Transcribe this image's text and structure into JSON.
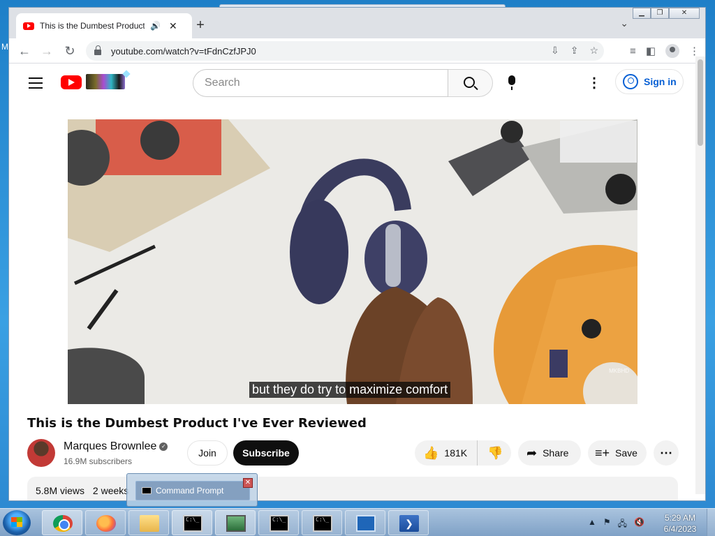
{
  "browser": {
    "tab_title": "This is the Dumbest Product I've Ever Reviewed",
    "url": "youtube.com/watch?v=tFdnCzfJPJ0"
  },
  "youtube": {
    "search_placeholder": "Search",
    "sign_in_label": "Sign in",
    "video": {
      "caption": "but they do try to maximize comfort",
      "watermark": "MKBHD",
      "title": "This is the Dumbest Product I've Ever Reviewed"
    },
    "channel": {
      "name": "Marques Brownlee",
      "subscribers": "16.9M subscribers"
    },
    "buttons": {
      "join": "Join",
      "subscribe": "Subscribe",
      "likes": "181K",
      "share": "Share",
      "save": "Save"
    },
    "description": {
      "views": "5.8M views",
      "age": "2 weeks"
    }
  },
  "desktop": {
    "edge_letter": "M"
  },
  "popup": {
    "label": "Command Prompt"
  },
  "taskbar": {
    "time": "5:29 AM",
    "date": "6/4/2023"
  },
  "colors": {
    "youtube_red": "#ff0000",
    "subscribe_bg": "#0f0f0f",
    "link_blue": "#065fd4"
  }
}
